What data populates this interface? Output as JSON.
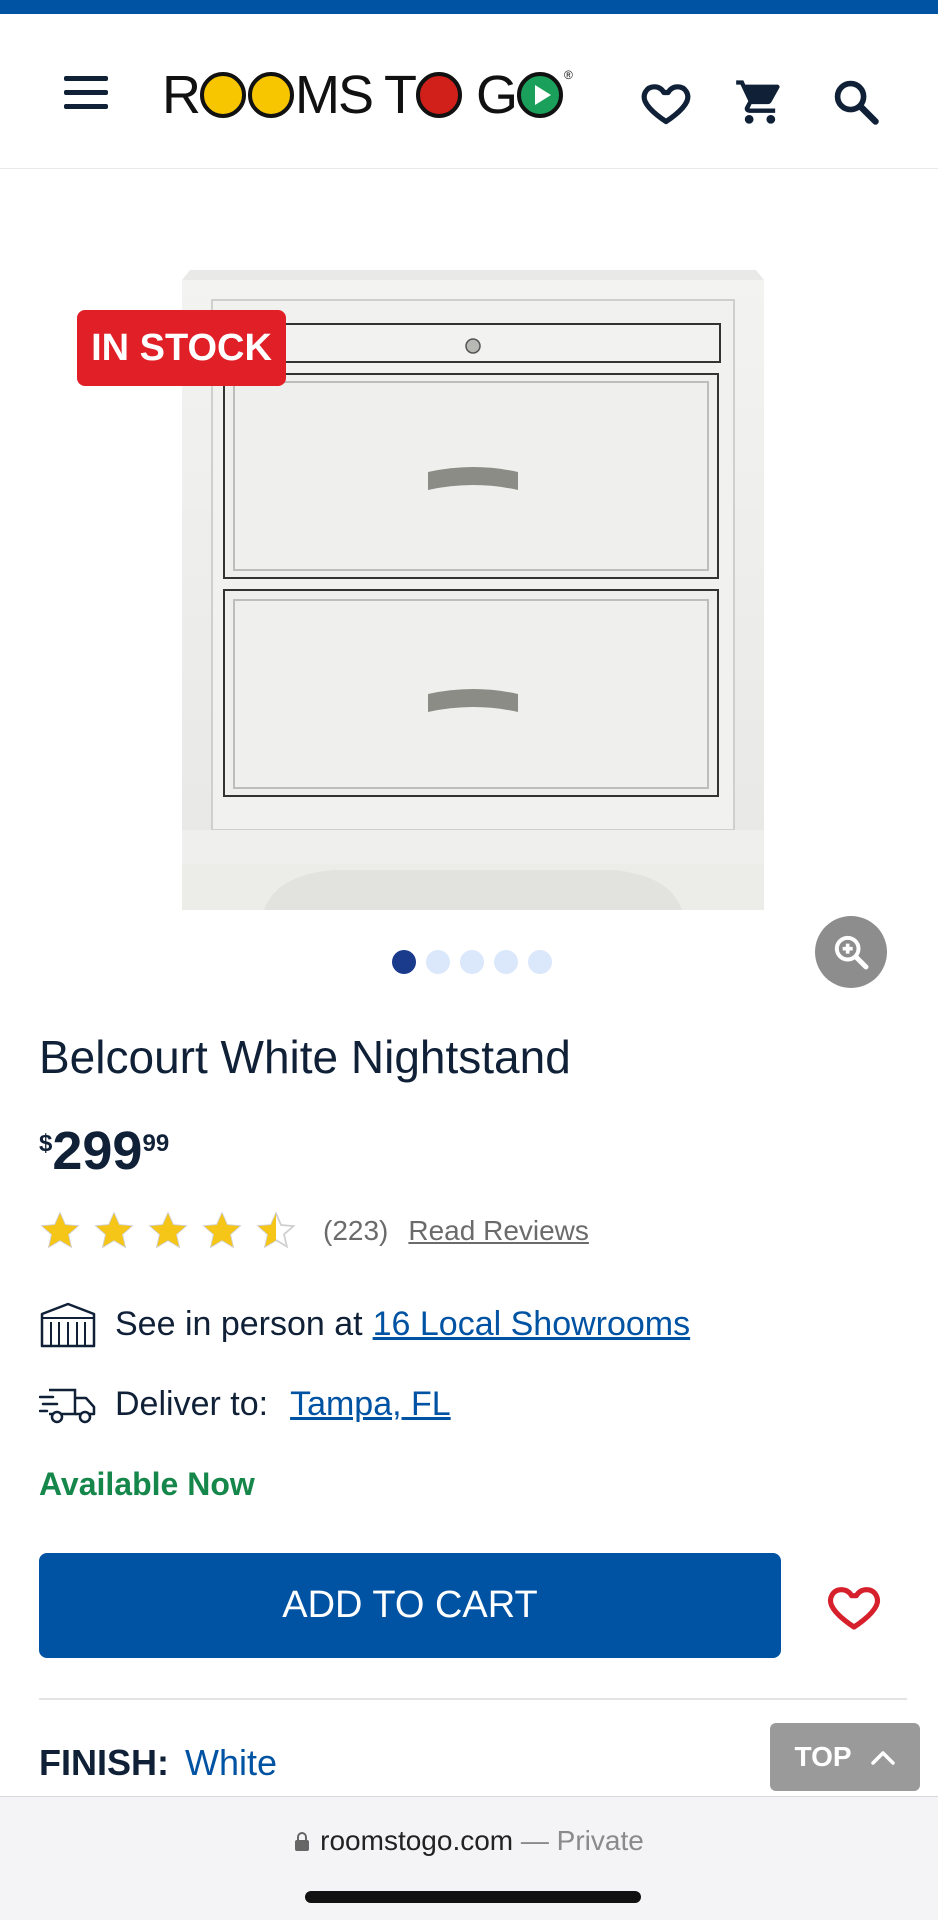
{
  "header": {
    "logo_text_a": "R",
    "logo_text_b": "MS T",
    "logo_text_c": "G",
    "icons": [
      "menu-icon",
      "heart-icon",
      "cart-icon",
      "search-icon"
    ]
  },
  "product": {
    "badge": "IN STOCK",
    "image_count": 5,
    "active_image": 1,
    "title": "Belcourt White Nightstand",
    "price_currency": "$",
    "price_dollars": "299",
    "price_cents": "99",
    "rating": 4.5,
    "review_count": "(223)",
    "read_reviews": "Read Reviews"
  },
  "showroom": {
    "prefix": "See in person at",
    "link": "16 Local Showrooms"
  },
  "delivery": {
    "prefix": "Deliver to:",
    "link": "Tampa, FL"
  },
  "availability": "Available Now",
  "actions": {
    "add_to_cart": "ADD TO CART"
  },
  "finish": {
    "label": "FINISH:",
    "value": "White"
  },
  "top_button": "TOP",
  "browser": {
    "domain": "roomstogo.com",
    "mode": "— Private"
  },
  "colors": {
    "brand_blue": "#0052a3",
    "badge_red": "#e01f26",
    "available_green": "#16874a",
    "star_yellow": "#f5c518"
  }
}
